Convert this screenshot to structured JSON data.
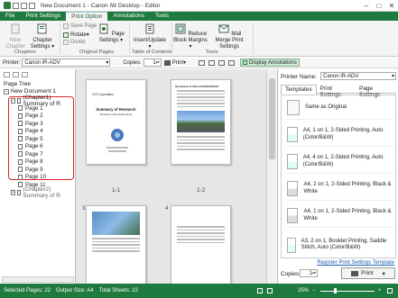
{
  "window": {
    "title": "New Document 1 - Canon iW Desktop - Editor"
  },
  "ribbon_tabs": [
    "File",
    "Print Settings",
    "Print Option",
    "Annotations",
    "Tools"
  ],
  "ribbon": {
    "new_chapter": "New Chapter",
    "chapter_settings": "Chapter Settings",
    "group_chapters": "Chapters",
    "save_page": "Save Page",
    "rotate": "Rotate",
    "divide": "Divide",
    "page_settings": "Page Settings",
    "group_original_pages": "Original Pages",
    "insert_update": "Insert/Update",
    "group_toc": "Table of Contents",
    "reduce_block_margins": "Reduce Block Margins",
    "mail_merge_print_settings": "Mail Merge Print Settings",
    "group_tools": "Tools"
  },
  "toolbar": {
    "printer_label": "Printer:",
    "printer_value": "Canon iR-ADV",
    "copies_label": "Copies:",
    "copies_value": "1",
    "print_label": "Print",
    "display_annotations": "Display Annotations"
  },
  "left_panel": {
    "title": "Page Tree",
    "root": "New Document 1",
    "chapter1": "(Chapter1) Summary of R",
    "pages": [
      "Page 1",
      "Page 2",
      "Page 3",
      "Page 4",
      "Page 5",
      "Page 6",
      "Page 7",
      "Page 8",
      "Page 9",
      "Page 10",
      "Page 11"
    ],
    "chapter2": "(Chapter2) Summary of R"
  },
  "doc": {
    "page_labels": [
      "1-1",
      "1-2",
      "3",
      "4"
    ],
    "page1_company": "XYZ Corporation",
    "page1_title": "Summary of Research",
    "page1_subtitle": "Summary of the product survey",
    "page2_heading": "Introduction of XXX & XXXXXXXXXXXX"
  },
  "right_panel": {
    "printer_name_label": "Printer Name:",
    "printer_name_value": "Canon iR-ADV",
    "tabs": [
      "Templates",
      "Print Settings",
      "Page Settings"
    ],
    "templates": [
      "Same as Original",
      "A4, 1 on 1, 2-Sided Printing, Auto (Color/B&W)",
      "A4, 4 on 1, 2-Sided Printing, Auto (Color/B&W)",
      "A4, 2 on 1, 2-Sided Printing, Black & White",
      "A4, 1 on 1, 2-Sided Printing, Black & White",
      "A3, 2 on 1, Booklet Printing, Saddle Stitch, Auto (Color/B&W)"
    ],
    "register_link": "Register Print Settings Template",
    "copies_label": "Copies:",
    "copies_value": "1",
    "print_label": "Print"
  },
  "status": {
    "selected_pages": "Selected Pages: 22",
    "output_size": "Output Size: A4",
    "total_sheets": "Total Sheets: 22",
    "zoom": "25%"
  },
  "colors": {
    "accent": "#1f7a3f",
    "highlight": "#e02020",
    "link": "#1a5fb4"
  }
}
